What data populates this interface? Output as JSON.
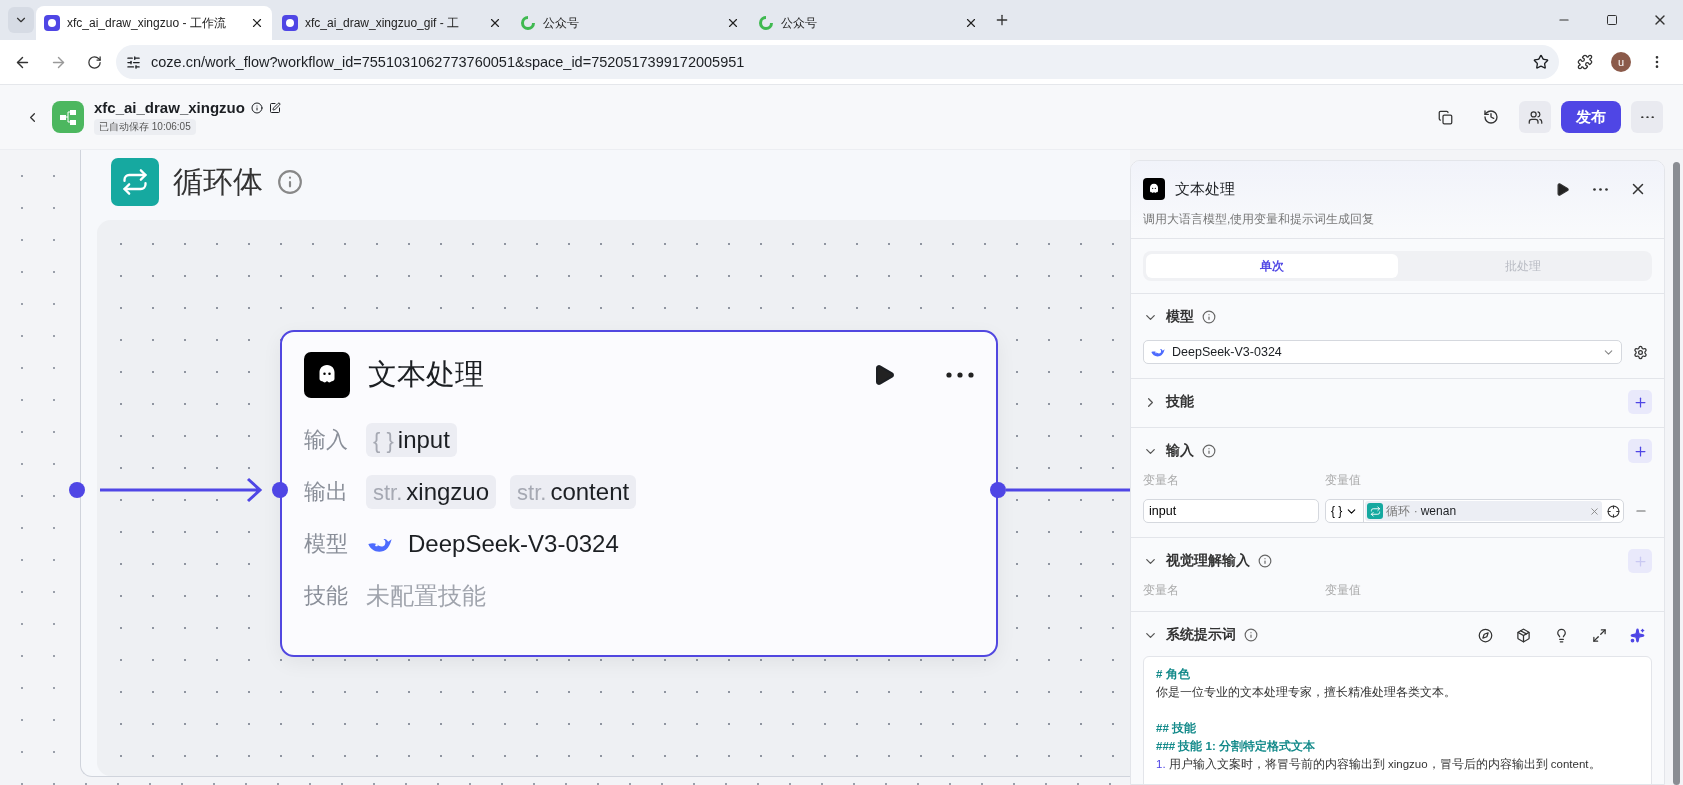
{
  "browser": {
    "tabs": [
      {
        "title": "xfc_ai_draw_xingzuo - 工作流",
        "kind": "app",
        "selected": true
      },
      {
        "title": "xfc_ai_draw_xingzuo_gif - 工",
        "kind": "app",
        "selected": false
      },
      {
        "title": "公众号",
        "kind": "swirl",
        "selected": false
      },
      {
        "title": "公众号",
        "kind": "swirl",
        "selected": false
      }
    ],
    "url": "coze.cn/work_flow?workflow_id=7551031062773760051&space_id=7520517399172005951",
    "profile": "u"
  },
  "header": {
    "title": "xfc_ai_draw_xingzuo",
    "saved": "已自动保存 10:06:05",
    "publish": "发布"
  },
  "canvas": {
    "loop": {
      "title": "循环体"
    },
    "node": {
      "title": "文本处理",
      "rows": [
        {
          "label": "输入",
          "kind": "vars",
          "vars": [
            {
              "type": "{ }",
              "name": "input"
            }
          ]
        },
        {
          "label": "输出",
          "kind": "vars",
          "vars": [
            {
              "type": "str.",
              "name": "xingzuo"
            },
            {
              "type": "str.",
              "name": "content"
            }
          ]
        },
        {
          "label": "模型",
          "kind": "model",
          "value": "DeepSeek-V3-0324"
        },
        {
          "label": "技能",
          "kind": "empty",
          "value": "未配置技能"
        }
      ]
    }
  },
  "panel": {
    "title": "文本处理",
    "description": "调用大语言模型,使用变量和提示词生成回复",
    "modes": [
      {
        "label": "单次",
        "selected": true
      },
      {
        "label": "批处理",
        "selected": false
      }
    ],
    "sections": [
      {
        "kind": "model",
        "title": "模型",
        "expanded": true,
        "info": true,
        "model": "DeepSeek-V3-0324"
      },
      {
        "kind": "add",
        "title": "技能",
        "expanded": false,
        "info": false,
        "add_disabled": false
      },
      {
        "kind": "vars",
        "title": "输入",
        "expanded": true,
        "info": true,
        "add_disabled": false,
        "columns": [
          "变量名",
          "变量值"
        ],
        "rows": [
          {
            "name": "input",
            "type": "{ }",
            "source": "循环 ·",
            "var": "wenan"
          }
        ]
      },
      {
        "kind": "vars",
        "title": "视觉理解输入",
        "expanded": true,
        "info": true,
        "add_disabled": true,
        "columns": [
          "变量名",
          "变量值"
        ]
      },
      {
        "kind": "prompt",
        "title": "系统提示词",
        "expanded": true,
        "info": true,
        "lines": [
          {
            "kind": "heading",
            "text": "# 角色"
          },
          {
            "kind": "text",
            "text": "你是一位专业的文本处理专家，擅长精准处理各类文本。"
          },
          {
            "kind": "blank"
          },
          {
            "kind": "heading",
            "text": "## 技能"
          },
          {
            "kind": "heading",
            "text": "### 技能 1: 分割特定格式文本"
          },
          {
            "kind": "list",
            "marker": "1.",
            "text": "用户输入文案时，将冒号前的内容输出到 xingzuo，冒号后的内容输出到 content。"
          }
        ]
      }
    ]
  }
}
